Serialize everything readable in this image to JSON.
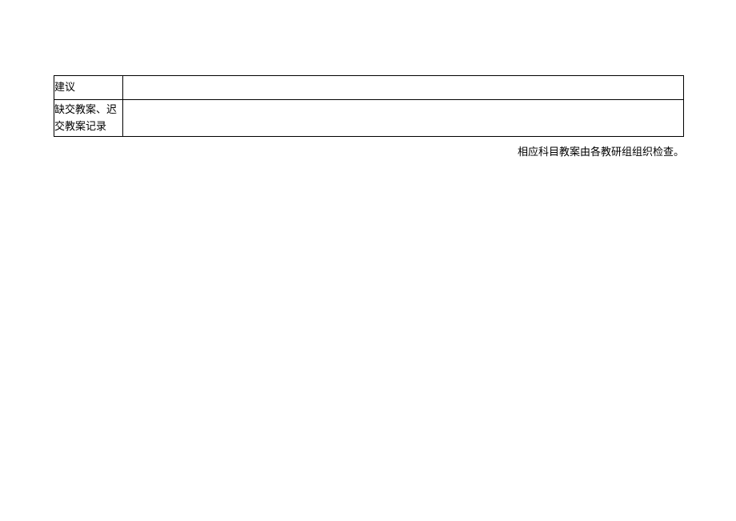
{
  "table": {
    "rows": [
      {
        "label": "建议",
        "content": ""
      },
      {
        "label": "缺交教案、迟交教案记录",
        "content": ""
      }
    ]
  },
  "footer_note": "相应科目教案由各教研组组织检查。"
}
